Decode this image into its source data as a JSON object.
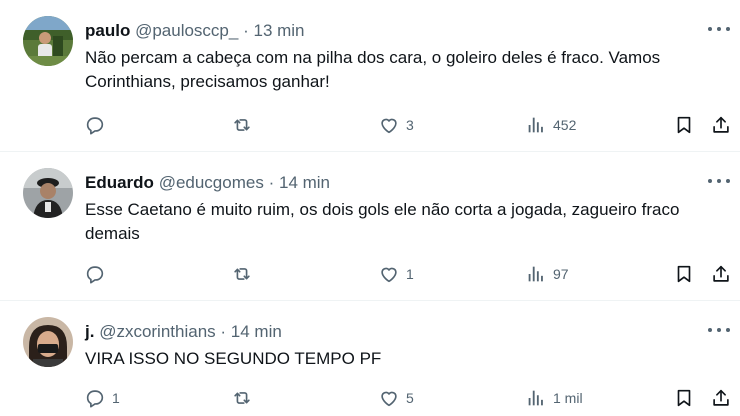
{
  "replies": [
    {
      "name": "paulo",
      "handle": "@paulosccp_",
      "dot": "·",
      "time": "13 min",
      "text": "Não percam a cabeça com na pilha dos cara, o goleiro deles é fraco. Vamos Corinthians, precisamos ganhar!",
      "replies_count": "",
      "likes": "3",
      "views": "452"
    },
    {
      "name": "Eduardo",
      "handle": "@educgomes",
      "dot": "·",
      "time": "14 min",
      "text": "Esse Caetano é muito ruim, os dois gols ele não corta a jogada, zagueiro fraco demais",
      "replies_count": "",
      "likes": "1",
      "views": "97"
    },
    {
      "name": "j.",
      "handle": "@zxcorinthians",
      "dot": "·",
      "time": "14 min",
      "text": "VIRA ISSO NO SEGUNDO TEMPO PF",
      "replies_count": "1",
      "likes": "5",
      "views": "1 mil"
    }
  ],
  "icons": {
    "reply": "reply-icon",
    "retweet": "retweet-icon",
    "like": "heart-icon",
    "views": "views-icon",
    "bookmark": "bookmark-icon",
    "share": "share-icon",
    "more": "more-icon"
  },
  "colors": {
    "text": "#0f1419",
    "secondary": "#536471",
    "divider": "#eff3f4"
  }
}
